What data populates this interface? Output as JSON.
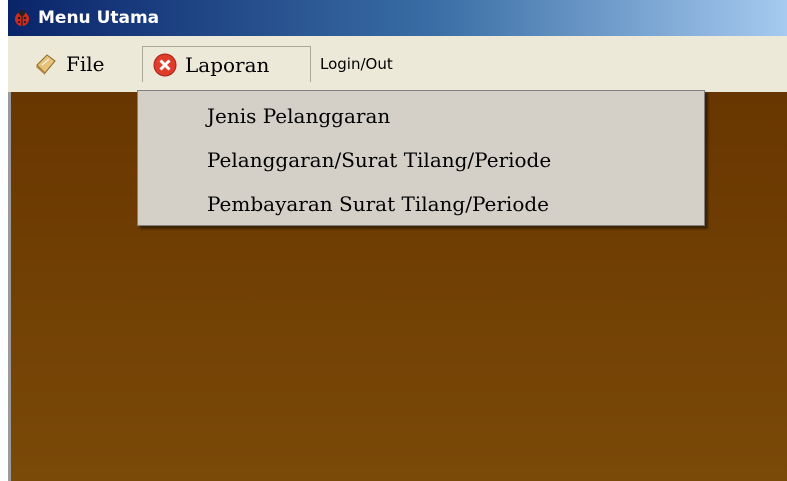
{
  "window": {
    "title": "Menu Utama",
    "title_icon": "app-ladybug-icon"
  },
  "menubar": {
    "items": [
      {
        "label": "File",
        "icon": "book-icon"
      },
      {
        "label": "Laporan",
        "icon": "red-x-icon"
      },
      {
        "label": "Login/Out"
      }
    ]
  },
  "dropdown": {
    "items": [
      {
        "label": "Jenis Pelanggaran"
      },
      {
        "label": "Pelanggaran/Surat Tilang/Periode"
      },
      {
        "label": "Pembayaran Surat Tilang/Periode"
      }
    ]
  },
  "colors": {
    "titlebar_start": "#0a246a",
    "titlebar_end": "#a6caf0",
    "menubar_bg": "#ece9d8",
    "content_top": "#683600",
    "content_bottom": "#7a4a08",
    "dropdown_bg": "#d4d0c8"
  }
}
